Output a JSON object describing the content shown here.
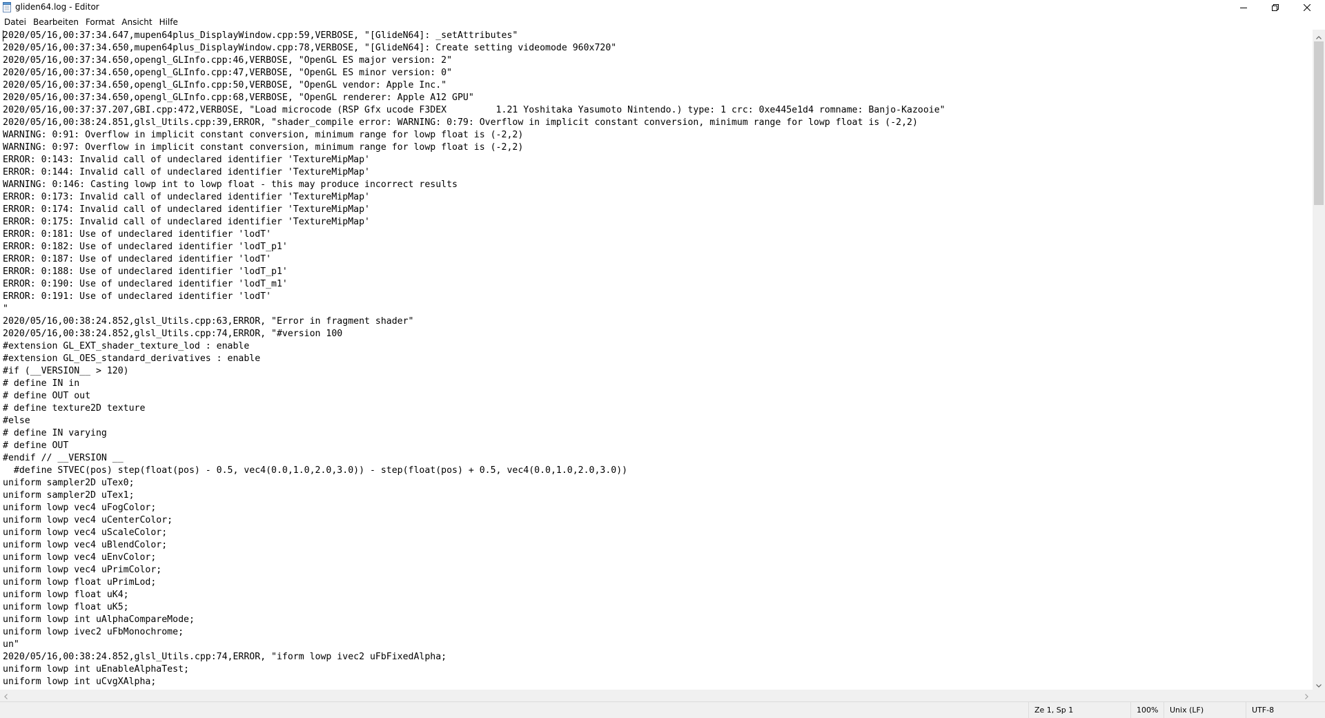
{
  "window": {
    "title": "gliden64.log - Editor",
    "icons": {
      "app": "notepad-icon",
      "minimize": "minimize-icon",
      "maximize": "restore-icon",
      "close": "close-icon"
    }
  },
  "menu": {
    "items": [
      "Datei",
      "Bearbeiten",
      "Format",
      "Ansicht",
      "Hilfe"
    ]
  },
  "editor": {
    "lines": [
      "2020/05/16,00:37:34.647,mupen64plus_DisplayWindow.cpp:59,VERBOSE, \"[GlideN64]: _setAttributes\"",
      "2020/05/16,00:37:34.650,mupen64plus_DisplayWindow.cpp:78,VERBOSE, \"[GlideN64]: Create setting videomode 960x720\"",
      "2020/05/16,00:37:34.650,opengl_GLInfo.cpp:46,VERBOSE, \"OpenGL ES major version: 2\"",
      "2020/05/16,00:37:34.650,opengl_GLInfo.cpp:47,VERBOSE, \"OpenGL ES minor version: 0\"",
      "2020/05/16,00:37:34.650,opengl_GLInfo.cpp:50,VERBOSE, \"OpenGL vendor: Apple Inc.\"",
      "2020/05/16,00:37:34.650,opengl_GLInfo.cpp:68,VERBOSE, \"OpenGL renderer: Apple A12 GPU\"",
      "2020/05/16,00:37:37.207,GBI.cpp:472,VERBOSE, \"Load microcode (RSP Gfx ucode F3DEX         1.21 Yoshitaka Yasumoto Nintendo.) type: 1 crc: 0xe445e1d4 romname: Banjo-Kazooie\"",
      "2020/05/16,00:38:24.851,glsl_Utils.cpp:39,ERROR, \"shader_compile error: WARNING: 0:79: Overflow in implicit constant conversion, minimum range for lowp float is (-2,2)",
      "WARNING: 0:91: Overflow in implicit constant conversion, minimum range for lowp float is (-2,2)",
      "WARNING: 0:97: Overflow in implicit constant conversion, minimum range for lowp float is (-2,2)",
      "ERROR: 0:143: Invalid call of undeclared identifier 'TextureMipMap'",
      "ERROR: 0:144: Invalid call of undeclared identifier 'TextureMipMap'",
      "WARNING: 0:146: Casting lowp int to lowp float - this may produce incorrect results",
      "ERROR: 0:173: Invalid call of undeclared identifier 'TextureMipMap'",
      "ERROR: 0:174: Invalid call of undeclared identifier 'TextureMipMap'",
      "ERROR: 0:175: Invalid call of undeclared identifier 'TextureMipMap'",
      "ERROR: 0:181: Use of undeclared identifier 'lodT'",
      "ERROR: 0:182: Use of undeclared identifier 'lodT_p1'",
      "ERROR: 0:187: Use of undeclared identifier 'lodT'",
      "ERROR: 0:188: Use of undeclared identifier 'lodT_p1'",
      "ERROR: 0:190: Use of undeclared identifier 'lodT_m1'",
      "ERROR: 0:191: Use of undeclared identifier 'lodT'",
      "\"",
      "2020/05/16,00:38:24.852,glsl_Utils.cpp:63,ERROR, \"Error in fragment shader\"",
      "2020/05/16,00:38:24.852,glsl_Utils.cpp:74,ERROR, \"#version 100",
      "#extension GL_EXT_shader_texture_lod : enable",
      "#extension GL_OES_standard_derivatives : enable",
      "#if (__VERSION__ > 120)",
      "# define IN in",
      "# define OUT out",
      "# define texture2D texture",
      "#else",
      "# define IN varying",
      "# define OUT",
      "#endif // __VERSION __",
      "  #define STVEC(pos) step(float(pos) - 0.5, vec4(0.0,1.0,2.0,3.0)) - step(float(pos) + 0.5, vec4(0.0,1.0,2.0,3.0))",
      "uniform sampler2D uTex0;",
      "uniform sampler2D uTex1;",
      "uniform lowp vec4 uFogColor;",
      "uniform lowp vec4 uCenterColor;",
      "uniform lowp vec4 uScaleColor;",
      "uniform lowp vec4 uBlendColor;",
      "uniform lowp vec4 uEnvColor;",
      "uniform lowp vec4 uPrimColor;",
      "uniform lowp float uPrimLod;",
      "uniform lowp float uK4;",
      "uniform lowp float uK5;",
      "uniform lowp int uAlphaCompareMode;",
      "uniform lowp ivec2 uFbMonochrome;",
      "un\"",
      "2020/05/16,00:38:24.852,glsl_Utils.cpp:74,ERROR, \"iform lowp ivec2 uFbFixedAlpha;",
      "uniform lowp int uEnableAlphaTest;",
      "uniform lowp int uCvgXAlpha;"
    ]
  },
  "statusbar": {
    "position": "Ze 1, Sp 1",
    "zoom": "100%",
    "line_ending": "Unix (LF)",
    "encoding": "UTF-8"
  },
  "scrollbars": {
    "vertical_position_fraction": 0.0,
    "vertical_visible_fraction": 0.25
  },
  "colors": {
    "background": "#ffffff",
    "chrome": "#f0f0f0",
    "text": "#000000",
    "scroll_thumb": "#cdcdcd"
  }
}
